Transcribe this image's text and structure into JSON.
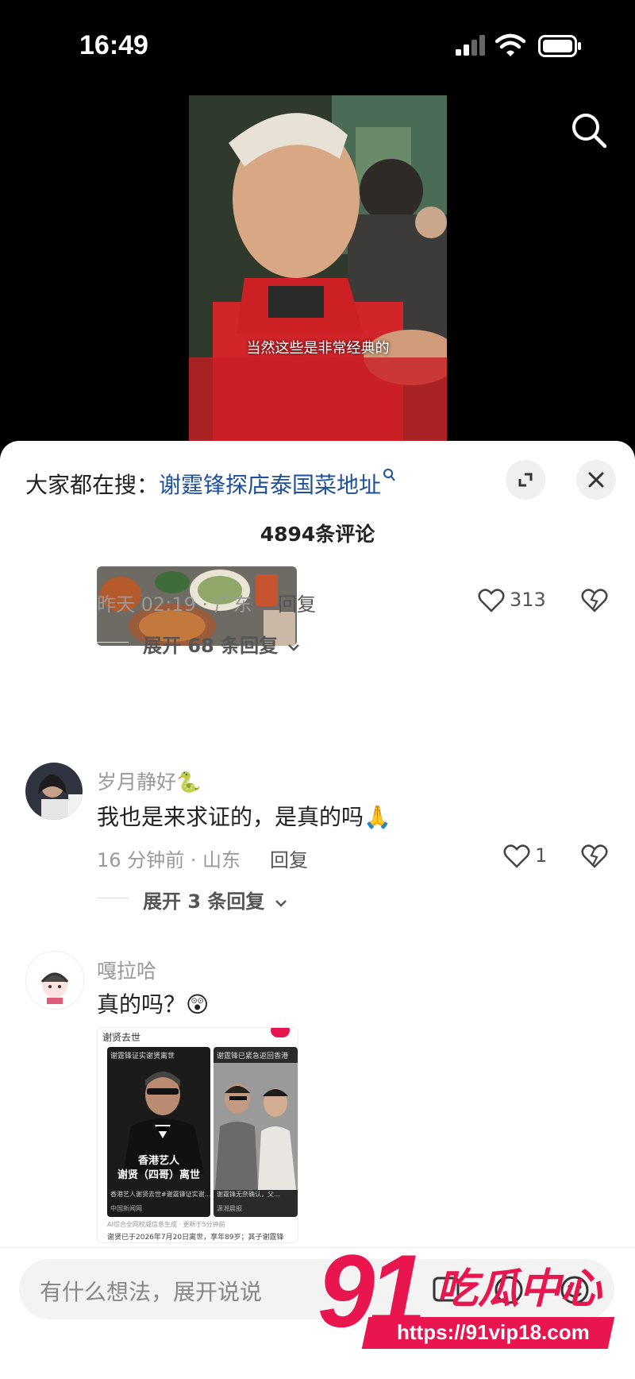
{
  "status_bar": {
    "time": "16:49"
  },
  "video": {
    "caption": "当然这些是非常经典的"
  },
  "sheet": {
    "trend_prefix": "大家都在搜：",
    "trend_keyword": "谢霆锋探店泰国菜地址",
    "comment_count": "4894条评论"
  },
  "comments": [
    {
      "meta": "昨天 02:19 · 广东",
      "reply_label": "回复",
      "likes": "313",
      "expand": "展开 68 条回复"
    },
    {
      "username": "岁月静好🐍",
      "text": "我也是来求证的，是真的吗🙏",
      "meta": "16 分钟前 · 山东",
      "reply_label": "回复",
      "likes": "1",
      "expand": "展开 3 条回复"
    },
    {
      "username": "嘎拉哈",
      "text": "真的吗？😲"
    }
  ],
  "news_card": {
    "title": "谢贤去世",
    "left_header": "谢霆锋证实谢贤离世",
    "headline_1": "香港艺人",
    "headline_2": "谢贤（四哥）离世",
    "left_footer": "香港艺人谢贤去世#谢霆锋证实谢…",
    "left_source": "中国新闻网",
    "right_header": "谢霆锋已紧急返回香港",
    "right_footer": "谢霆锋无奈确认，父…",
    "right_source": "潇湘晨报",
    "ai_note": "AI综合全网权威信息生成 · 更新于5分钟前",
    "bottom_text": "谢贤已于2026年7月20日离世，享年89岁；其子谢霆锋"
  },
  "input": {
    "placeholder": "有什么想法，展开说说"
  },
  "watermark": {
    "text_1": "91",
    "text_2": "吃瓜中心",
    "url": "https://91vip18.com"
  },
  "colors": {
    "accent_link": "#1d4f9a",
    "watermark_red": "#e8154f"
  }
}
